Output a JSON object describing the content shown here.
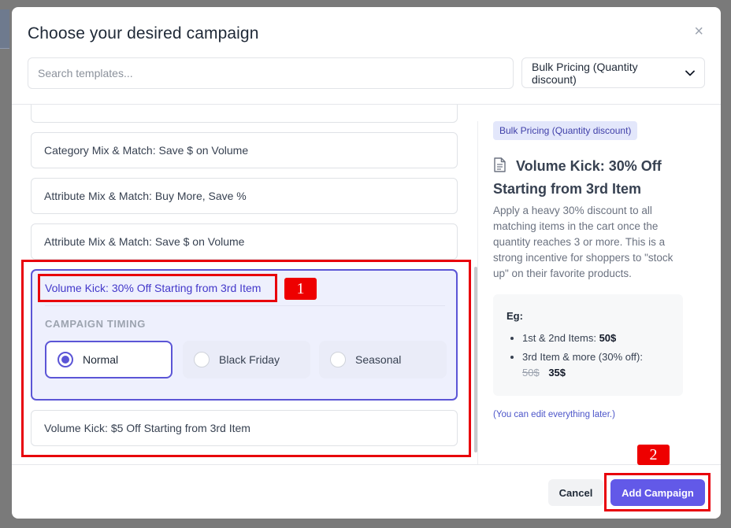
{
  "modal": {
    "title": "Choose your desired campaign",
    "close_glyph": "×"
  },
  "search": {
    "placeholder": "Search templates...",
    "value": ""
  },
  "filter": {
    "selected": "Bulk Pricing (Quantity discount)",
    "chevron": "⌄"
  },
  "templates": [
    {
      "label": "Category Mix & Match: Save $ on Volume"
    },
    {
      "label": "Attribute Mix & Match: Buy More, Save %"
    },
    {
      "label": "Attribute Mix & Match: Save $ on Volume"
    },
    {
      "label": "Volume Kick: 30% Off Starting from 3rd Item",
      "selected": true
    },
    {
      "label": "Volume Kick: $5 Off Starting from 3rd Item"
    }
  ],
  "timing": {
    "heading": "CAMPAIGN TIMING",
    "options": [
      {
        "label": "Normal",
        "selected": true
      },
      {
        "label": "Black Friday",
        "selected": false
      },
      {
        "label": "Seasonal",
        "selected": false
      }
    ]
  },
  "preview": {
    "badge": "Bulk Pricing (Quantity discount)",
    "title": "Volume Kick: 30% Off Starting from 3rd Item",
    "description": "Apply a heavy 30% discount to all matching items in the cart once the quantity reaches 3 or more. This is a strong incentive for shoppers to \"stock up\" on their favorite products.",
    "example": {
      "label": "Eg:",
      "item1_label": "1st & 2nd Items:",
      "item1_price": "50$",
      "item2_label": "3rd Item & more (30% off):",
      "item2_old": "50$",
      "item2_new": "35$"
    },
    "hint": "(You can edit everything later.)"
  },
  "footer": {
    "cancel": "Cancel",
    "add": "Add Campaign"
  },
  "annotations": [
    "1",
    "2"
  ],
  "colors": {
    "accent": "#6259e8",
    "selected_border": "#5b55d6",
    "annotation": "#e8000b"
  },
  "icons": {
    "close": "close-icon",
    "dropdown": "chevron-down-icon",
    "preview": "document-icon"
  }
}
